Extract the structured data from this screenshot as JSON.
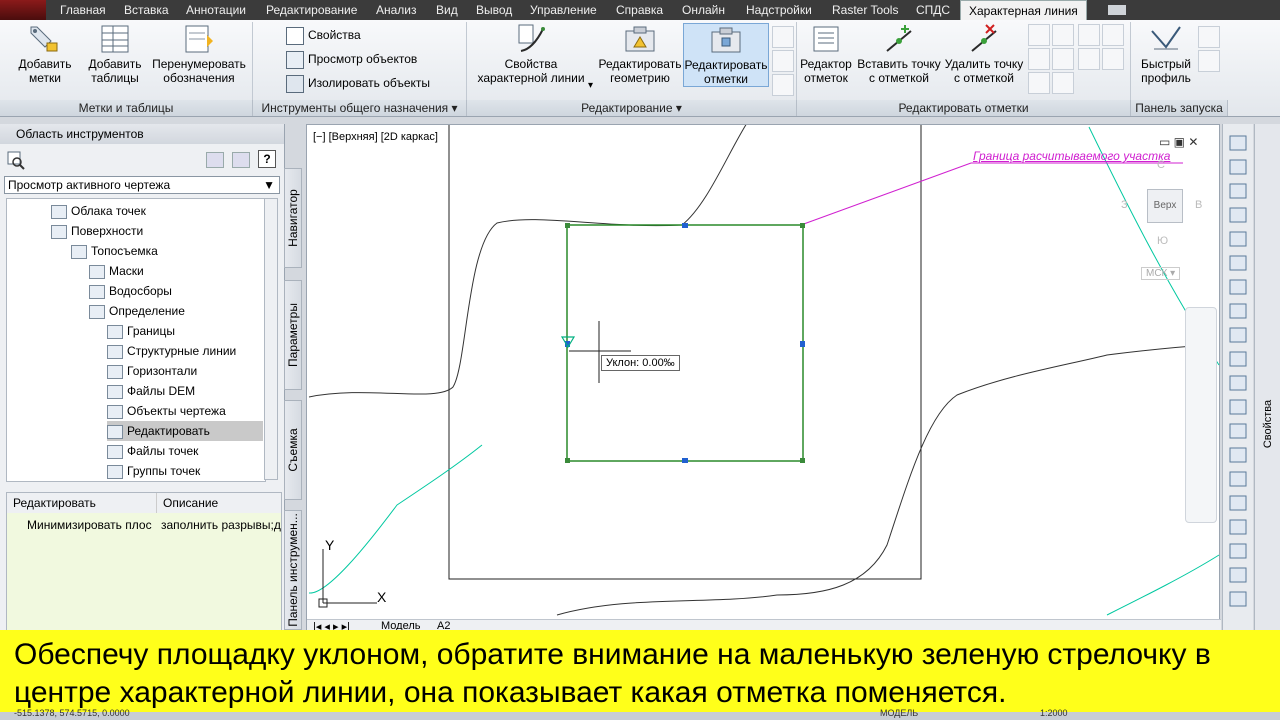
{
  "ribbon_tabs": [
    "Главная",
    "Вставка",
    "Аннотации",
    "Редактирование",
    "Анализ",
    "Вид",
    "Вывод",
    "Управление",
    "Справка",
    "Онлайн",
    "Надстройки",
    "Raster Tools",
    "СПДС",
    "Характерная линия"
  ],
  "ribbon": {
    "labels": {
      "add_labels": "Добавить\nметки",
      "add_tables": "Добавить\nтаблицы",
      "renumber": "Перенумеровать\nобозначения",
      "properties": "Свойства",
      "view_objects": "Просмотр объектов",
      "isolate": "Изолировать объекты",
      "featureline_props": "Свойства\nхарактерной линии",
      "edit_geometry": "Редактировать\nгеометрию",
      "edit_elevations": "Редактировать\nотметки",
      "elevation_editor": "Редактор\nотметок",
      "insert_pi": "Вставить точку\nс отметкой",
      "delete_pi": "Удалить точку\nс отметкой",
      "quick_profile": "Быстрый\nпрофиль"
    },
    "panels": [
      "Метки и таблицы",
      "Инструменты общего назначения",
      "Редактирование",
      "Редактировать отметки",
      "Панель запуска"
    ]
  },
  "palette": {
    "title": "Область инструментов",
    "view_select": "Просмотр активного чертежа",
    "tree": [
      "Облака точек",
      "Поверхности",
      "Топосъемка",
      "Маски",
      "Водосборы",
      "Определение",
      "Границы",
      "Структурные линии",
      "Горизонтали",
      "Файлы DEM",
      "Объекты чертежа",
      "Редактировать",
      "Файлы точек",
      "Группы точек"
    ],
    "tabs": [
      "Навигатор",
      "Параметры",
      "Съемка",
      "Панель инструмен..."
    ],
    "grid_headers": [
      "Редактировать",
      "Описание"
    ],
    "grid_row": [
      "Минимизировать плос",
      "заполнить разрывы;до"
    ]
  },
  "viewport": {
    "label": "[−] [Верхняя] [2D каркас]",
    "annotation": "Граница расчитываемого участка",
    "tooltip": "Уклон: 0.00‰",
    "viewcube": "Верх",
    "compass": [
      "С",
      "Ю",
      "З",
      "В"
    ],
    "ucs": "МСК",
    "axis_x": "X",
    "axis_y": "Y",
    "tabs": [
      "Модель",
      "A2"
    ]
  },
  "right_panel_label": "Свойства",
  "caption": "Обеспечу площадку уклоном, обратите внимание на маленькую зеленую стрелочку в центре характерной линии, она показывает какая отметка поменяется.",
  "status": {
    "coords": "-515.1378, 574.5715, 0.0000",
    "model": "МОДЕЛЬ",
    "scale": "1:2000"
  }
}
